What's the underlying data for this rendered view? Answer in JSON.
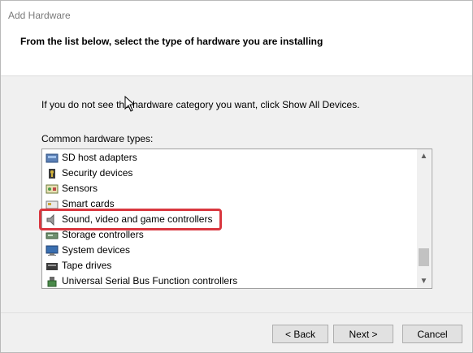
{
  "window": {
    "title": "Add Hardware",
    "heading": "From the list below, select the type of hardware you are installing"
  },
  "content": {
    "hint": "If you do not see the hardware category you want, click Show All Devices.",
    "list_label": "Common hardware types:",
    "items": [
      {
        "label": "SD host adapters",
        "icon": "sd-host-adapter-icon"
      },
      {
        "label": "Security devices",
        "icon": "security-device-icon"
      },
      {
        "label": "Sensors",
        "icon": "sensor-icon"
      },
      {
        "label": "Smart cards",
        "icon": "smart-card-icon"
      },
      {
        "label": "Sound, video and game controllers",
        "icon": "speaker-icon",
        "highlighted": true
      },
      {
        "label": "Storage controllers",
        "icon": "storage-controller-icon"
      },
      {
        "label": "System devices",
        "icon": "system-device-icon"
      },
      {
        "label": "Tape drives",
        "icon": "tape-drive-icon"
      },
      {
        "label": "Universal Serial Bus Function controllers",
        "icon": "usb-icon"
      }
    ],
    "highlight_color": "#d9373f"
  },
  "buttons": {
    "back": "< Back",
    "next": "Next >",
    "cancel": "Cancel"
  }
}
